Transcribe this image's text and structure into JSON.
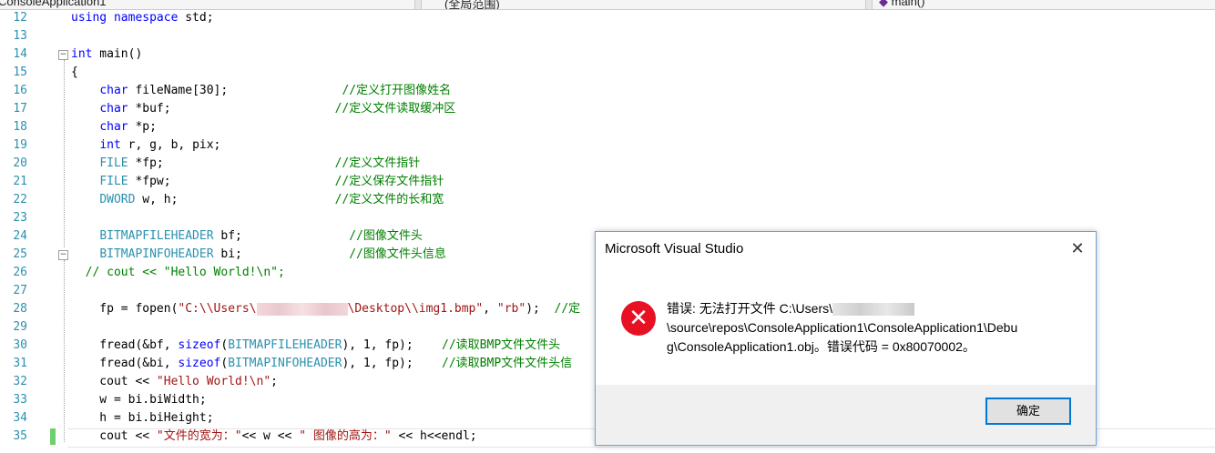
{
  "tabs": {
    "project": "ConsoleApplication1",
    "scope": "(全局范围)",
    "member": "main()"
  },
  "editor": {
    "lines": [
      {
        "n": "12",
        "parts": [
          {
            "c": "kw",
            "t": "using namespace"
          },
          {
            "c": "",
            "t": " std;"
          }
        ]
      },
      {
        "n": "13",
        "parts": []
      },
      {
        "n": "14",
        "parts": [
          {
            "c": "kw",
            "t": "int"
          },
          {
            "c": "",
            "t": " main()"
          }
        ]
      },
      {
        "n": "15",
        "parts": [
          {
            "c": "",
            "t": "{"
          }
        ]
      },
      {
        "n": "16",
        "parts": [
          {
            "c": "",
            "t": "    "
          },
          {
            "c": "kw",
            "t": "char"
          },
          {
            "c": "",
            "t": " fileName[30];                "
          },
          {
            "c": "cm",
            "t": "//定义打开图像姓名"
          }
        ]
      },
      {
        "n": "17",
        "parts": [
          {
            "c": "",
            "t": "    "
          },
          {
            "c": "kw",
            "t": "char"
          },
          {
            "c": "",
            "t": " *buf;                       "
          },
          {
            "c": "cm",
            "t": "//定义文件读取缓冲区"
          }
        ]
      },
      {
        "n": "18",
        "parts": [
          {
            "c": "",
            "t": "    "
          },
          {
            "c": "kw",
            "t": "char"
          },
          {
            "c": "",
            "t": " *p;"
          }
        ]
      },
      {
        "n": "19",
        "parts": [
          {
            "c": "",
            "t": "    "
          },
          {
            "c": "kw",
            "t": "int"
          },
          {
            "c": "",
            "t": " r, g, b, pix;"
          }
        ]
      },
      {
        "n": "20",
        "parts": [
          {
            "c": "",
            "t": "    "
          },
          {
            "c": "ty",
            "t": "FILE"
          },
          {
            "c": "",
            "t": " *fp;                        "
          },
          {
            "c": "cm",
            "t": "//定义文件指针"
          }
        ]
      },
      {
        "n": "21",
        "parts": [
          {
            "c": "",
            "t": "    "
          },
          {
            "c": "ty",
            "t": "FILE"
          },
          {
            "c": "",
            "t": " *fpw;                       "
          },
          {
            "c": "cm",
            "t": "//定义保存文件指针"
          }
        ]
      },
      {
        "n": "22",
        "parts": [
          {
            "c": "",
            "t": "    "
          },
          {
            "c": "ty",
            "t": "DWORD"
          },
          {
            "c": "",
            "t": " w, h;                      "
          },
          {
            "c": "cm",
            "t": "//定义文件的长和宽"
          }
        ]
      },
      {
        "n": "23",
        "parts": []
      },
      {
        "n": "24",
        "parts": [
          {
            "c": "",
            "t": "    "
          },
          {
            "c": "ty",
            "t": "BITMAPFILEHEADER"
          },
          {
            "c": "",
            "t": " bf;               "
          },
          {
            "c": "cm",
            "t": "//图像文件头"
          }
        ]
      },
      {
        "n": "25",
        "parts": [
          {
            "c": "",
            "t": "    "
          },
          {
            "c": "ty",
            "t": "BITMAPINFOHEADER"
          },
          {
            "c": "",
            "t": " bi;               "
          },
          {
            "c": "cm",
            "t": "//图像文件头信息"
          }
        ]
      },
      {
        "n": "26",
        "parts": [
          {
            "c": "cm",
            "t": "  // cout << \"Hello World!\\n\";"
          }
        ]
      },
      {
        "n": "27",
        "parts": []
      },
      {
        "n": "28",
        "parts": [
          {
            "c": "",
            "t": "    fp = fopen("
          },
          {
            "c": "str",
            "t": "\"C:\\\\Users\\"
          },
          {
            "c": "blur",
            "t": ""
          },
          {
            "c": "str",
            "t": "\\Desktop\\\\img1.bmp\""
          },
          {
            "c": "",
            "t": ", "
          },
          {
            "c": "str",
            "t": "\"rb\""
          },
          {
            "c": "",
            "t": ");  "
          },
          {
            "c": "cm",
            "t": "//定"
          }
        ]
      },
      {
        "n": "29",
        "parts": []
      },
      {
        "n": "30",
        "parts": [
          {
            "c": "",
            "t": "    fread(&bf, "
          },
          {
            "c": "kw",
            "t": "sizeof"
          },
          {
            "c": "",
            "t": "("
          },
          {
            "c": "ty",
            "t": "BITMAPFILEHEADER"
          },
          {
            "c": "",
            "t": "), 1, fp);    "
          },
          {
            "c": "cm",
            "t": "//读取BMP文件文件头"
          }
        ]
      },
      {
        "n": "31",
        "parts": [
          {
            "c": "",
            "t": "    fread(&bi, "
          },
          {
            "c": "kw",
            "t": "sizeof"
          },
          {
            "c": "",
            "t": "("
          },
          {
            "c": "ty",
            "t": "BITMAPINFOHEADER"
          },
          {
            "c": "",
            "t": "), 1, fp);    "
          },
          {
            "c": "cm",
            "t": "//读取BMP文件文件头信"
          }
        ]
      },
      {
        "n": "32",
        "parts": [
          {
            "c": "",
            "t": "    cout << "
          },
          {
            "c": "str",
            "t": "\"Hello World!\\n\""
          },
          {
            "c": "",
            "t": ";"
          }
        ]
      },
      {
        "n": "33",
        "parts": [
          {
            "c": "",
            "t": "    w = bi.biWidth;"
          }
        ]
      },
      {
        "n": "34",
        "parts": [
          {
            "c": "",
            "t": "    h = bi.biHeight;"
          }
        ]
      },
      {
        "n": "35",
        "parts": [
          {
            "c": "",
            "t": "    cout << "
          },
          {
            "c": "str",
            "t": "\"文件的宽为：\""
          },
          {
            "c": "",
            "t": "<< w << "
          },
          {
            "c": "str",
            "t": "\" 图像的高为：\""
          },
          {
            "c": "",
            "t": " << h<<endl;"
          }
        ]
      }
    ]
  },
  "dialog": {
    "title": "Microsoft Visual Studio",
    "close_glyph": "✕",
    "icon_glyph": "✕",
    "message_line1_prefix": "错误: 无法打开文件 C:\\Users\\",
    "message_line2": "\\source\\repos\\ConsoleApplication1\\ConsoleApplication1\\Debu",
    "message_line3": "g\\ConsoleApplication1.obj。错误代码 = 0x80070002。",
    "ok_label": "确定"
  },
  "colors": {
    "keyword": "#0000ff",
    "type": "#2b91af",
    "string": "#a31515",
    "comment": "#008000",
    "error_icon": "#e81123",
    "button_focus": "#0078d7"
  }
}
